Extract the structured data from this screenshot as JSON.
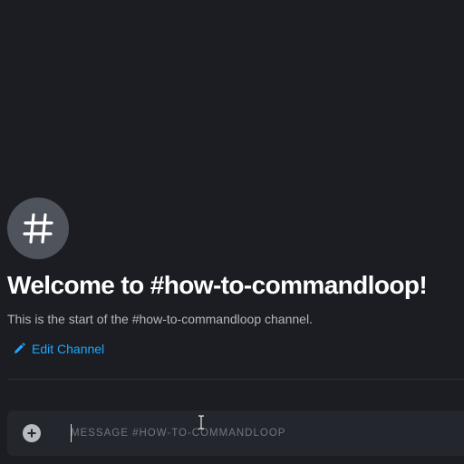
{
  "channel": {
    "icon": "hash-icon",
    "welcome_title": "Welcome to #how-to-commandloop!",
    "intro": "This is the start of the #how-to-commandloop channel.",
    "edit_label": "Edit Channel",
    "edit_icon": "pencil-icon"
  },
  "composer": {
    "attach_icon": "plus-circle-icon",
    "placeholder": "MESSAGE #HOW-TO-COMMANDLOOP",
    "value": ""
  },
  "colors": {
    "background": "#1b1d22",
    "accent_link": "#1ea7ff",
    "icon_circle": "#4f545c",
    "composer_bg": "#23262c"
  }
}
